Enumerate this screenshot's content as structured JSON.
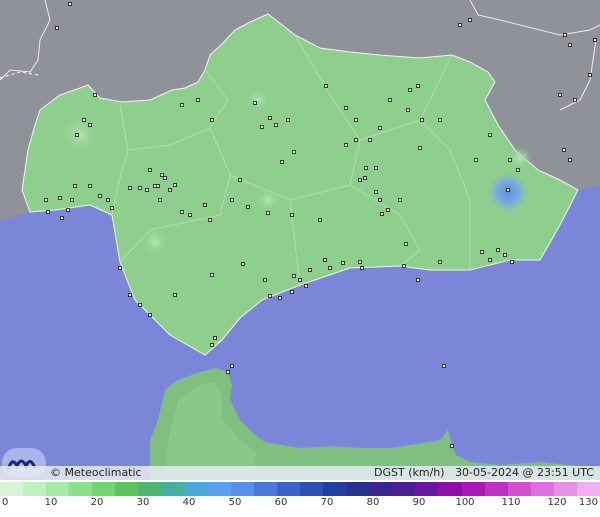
{
  "map": {
    "copyright_label": "© Meteoclimatic",
    "variable_label": "DGST (km/h)",
    "timestamp": "30-05-2024 @ 23:51 UTC",
    "colors": {
      "sea": "#7b86d8",
      "foreign_land": "#8f9299",
      "land_highlight": "#8ecf8e",
      "land_dark": "#7fbf80",
      "station_marker": "#111111",
      "gust_spot": "#7aa6e8"
    }
  },
  "legend": {
    "tick_labels": [
      "0",
      "10",
      "20",
      "30",
      "40",
      "50",
      "60",
      "70",
      "80",
      "90",
      "100",
      "110",
      "120",
      "130"
    ],
    "scale_colors": [
      "#d8f5d8",
      "#bff0bf",
      "#a6eaa6",
      "#8ce08c",
      "#72d472",
      "#5ec35e",
      "#4fb56e",
      "#45b0a0",
      "#4aa8d8",
      "#5ca0f0",
      "#5a8fe8",
      "#4a7ad8",
      "#3a64c8",
      "#2c50b4",
      "#203fa0",
      "#2a3090",
      "#3a2690",
      "#4e1e96",
      "#6a169e",
      "#8a10a8",
      "#aa18b4",
      "#c030c0",
      "#d050d0",
      "#dd70dd",
      "#e890e8",
      "#f0b0f0"
    ]
  }
}
